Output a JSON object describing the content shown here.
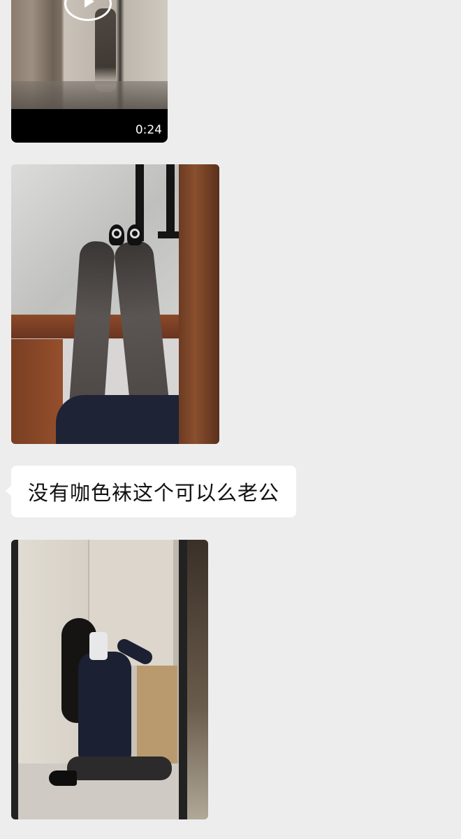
{
  "messages": {
    "video": {
      "duration": "0:24"
    },
    "text": {
      "content": "没有咖色袜这个可以么老公"
    }
  },
  "colors": {
    "background": "#ededed",
    "bubble": "#ffffff"
  }
}
